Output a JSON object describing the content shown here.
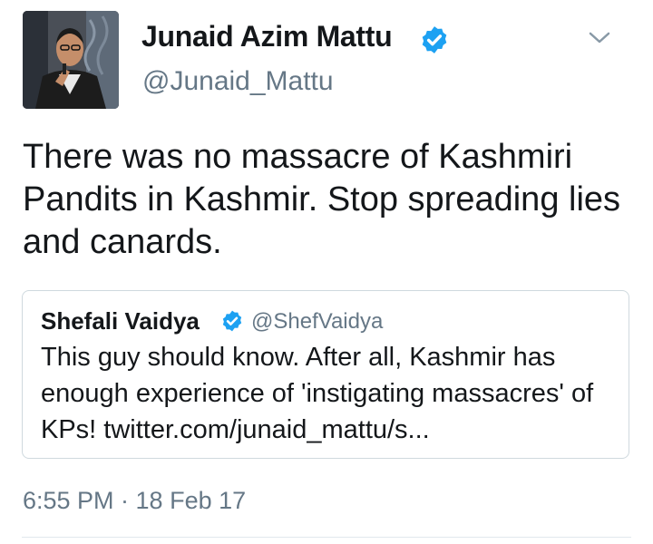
{
  "tweet": {
    "author_name": "Junaid Azim Mattu",
    "author_handle": "@Junaid_Mattu",
    "text": "There was no massacre of Kashmiri Pandits in Kashmir. Stop spreading lies and canards.",
    "timestamp": "6:55 PM · 18 Feb 17"
  },
  "quoted_tweet": {
    "author_name": "Shefali Vaidya",
    "author_handle": "@ShefVaidya",
    "text": "This guy should know. After all, Kashmir has enough experience of 'instigating massacres' of KPs! twitter.com/junaid_mattu/s..."
  },
  "icons": {
    "verified": "verified-badge-icon",
    "menu": "chevron-down-icon"
  },
  "colors": {
    "verified_blue": "#1da1f2",
    "secondary_text": "#657786",
    "primary_text": "#14171a",
    "border": "#cfd9de"
  }
}
